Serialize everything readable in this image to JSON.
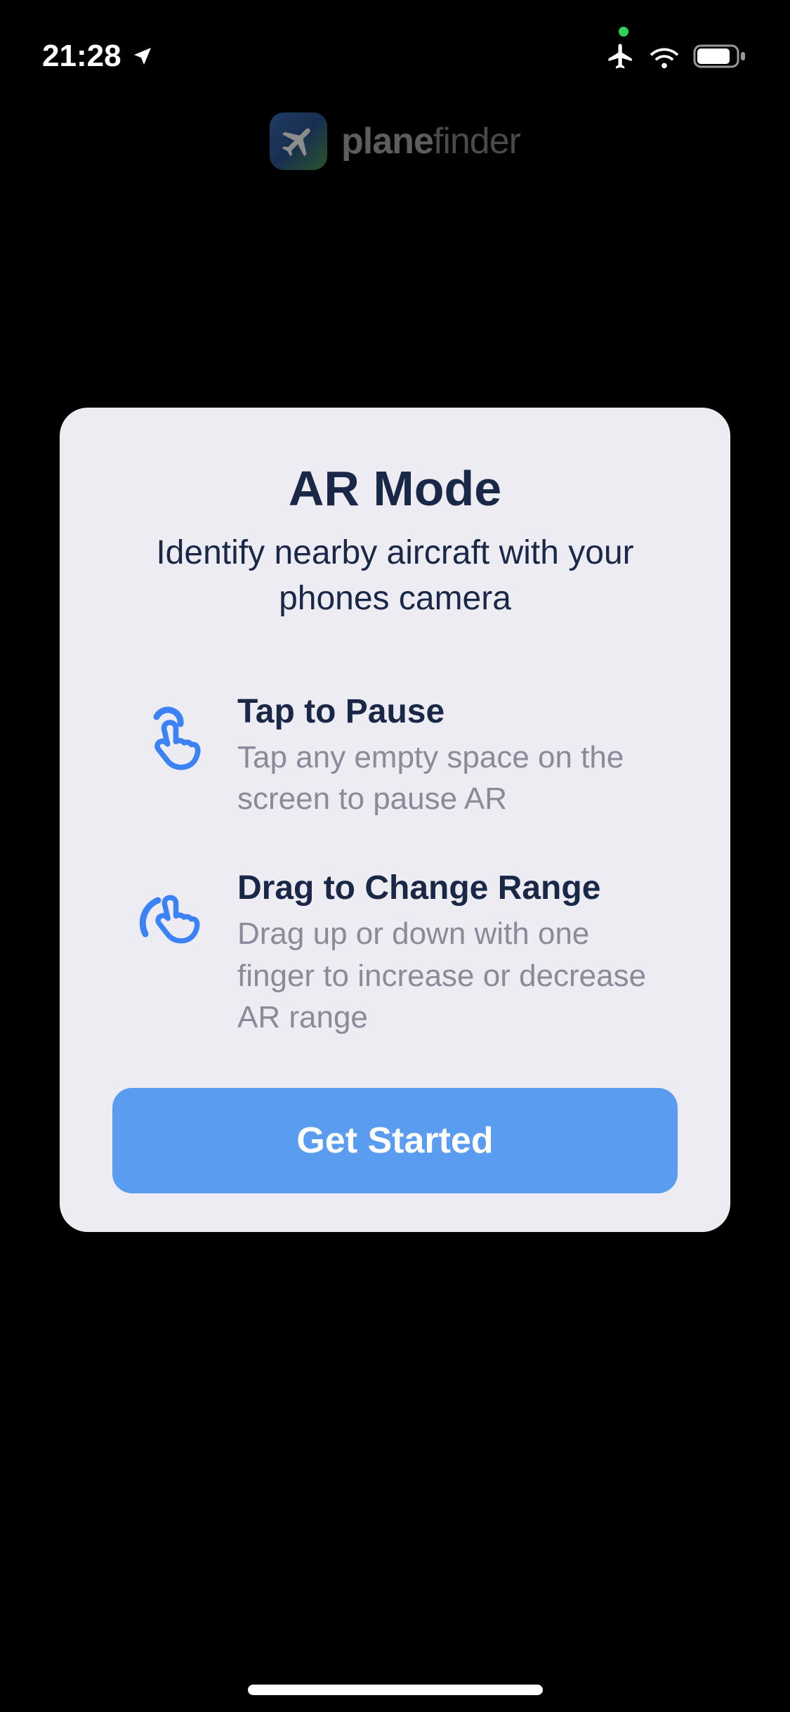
{
  "status": {
    "time": "21:28"
  },
  "logo": {
    "name_bold": "plane",
    "name_thin": "finder"
  },
  "modal": {
    "title": "AR Mode",
    "subtitle": "Identify nearby aircraft with your phones camera",
    "features": [
      {
        "title": "Tap to Pause",
        "desc": "Tap any empty space on the screen to pause AR"
      },
      {
        "title": "Drag to Change Range",
        "desc": "Drag up or down with one finger to increase or decrease AR range"
      }
    ],
    "cta": "Get Started"
  }
}
